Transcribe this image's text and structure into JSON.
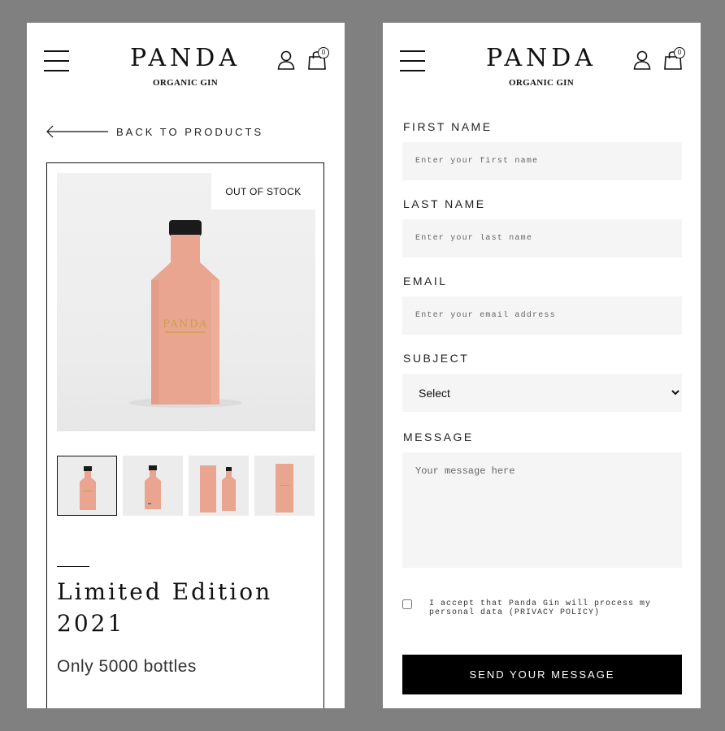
{
  "header": {
    "logo_name": "PANDA",
    "logo_tagline": "ORGANIC GIN",
    "cart_count": "0"
  },
  "product": {
    "back_label": "BACK TO PRODUCTS",
    "stock_badge": "OUT OF STOCK",
    "bottle_logo": "PANDA",
    "title": "Limited Edition 2021",
    "subtitle": "Only 5000 bottles",
    "thumbnails": [
      "bottle-front",
      "bottle-back",
      "bottle-with-box",
      "gift-box"
    ]
  },
  "form": {
    "first_name_label": "FIRST NAME",
    "first_name_placeholder": "Enter your first name",
    "last_name_label": "LAST NAME",
    "last_name_placeholder": "Enter your last name",
    "email_label": "EMAIL",
    "email_placeholder": "Enter your email address",
    "subject_label": "SUBJECT",
    "subject_selected": "Select",
    "message_label": "MESSAGE",
    "message_placeholder": "Your message here",
    "consent_text": "I accept that Panda Gin will process my personal data (PRIVACY POLICY)",
    "submit_label": "SEND YOUR MESSAGE"
  },
  "colors": {
    "bottle": "#e9a590",
    "field_bg": "#f5f5f5",
    "button_bg": "#000000",
    "frame_bg": "#808080"
  }
}
